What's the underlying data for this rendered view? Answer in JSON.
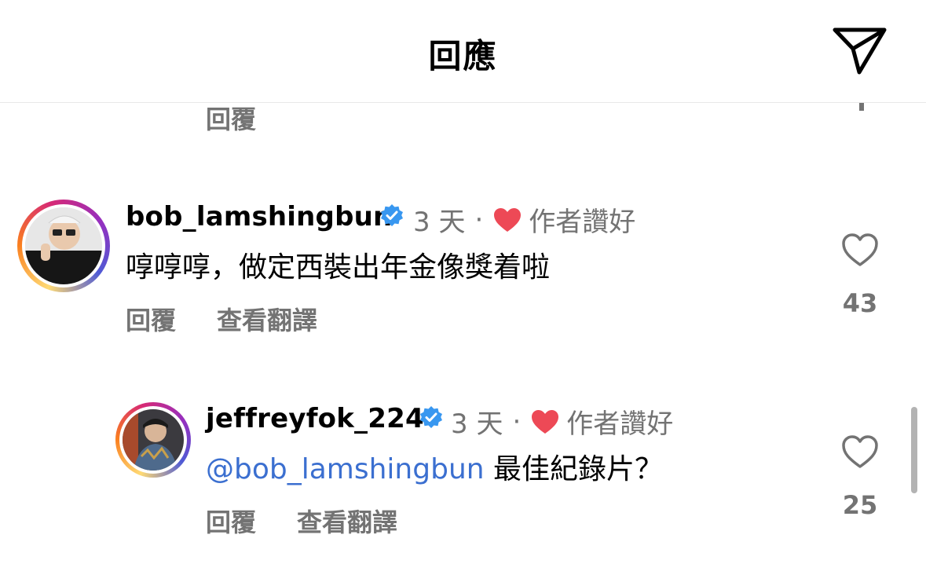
{
  "header": {
    "title": "回應"
  },
  "previous": {
    "reply_label": "回覆"
  },
  "comments": [
    {
      "username": "bob_lamshingbun",
      "time": "3 天",
      "dot": "·",
      "author_liked": "作者讚好",
      "text": "啍啍啍，做定西裝出年金像獎着啦",
      "reply_label": "回覆",
      "translate_label": "查看翻譯",
      "like_count": "43"
    },
    {
      "username": "jeffreyfok_224",
      "time": "3 天",
      "dot": "·",
      "author_liked": "作者讚好",
      "mention": "@bob_lamshingbun",
      "text": " 最佳紀錄片？",
      "reply_label": "回覆",
      "translate_label": "查看翻譯",
      "like_count": "25"
    }
  ],
  "colors": {
    "muted": "#737373",
    "verified": "#3897f0",
    "heart": "#ed4956",
    "mention": "#3b6fd0"
  }
}
